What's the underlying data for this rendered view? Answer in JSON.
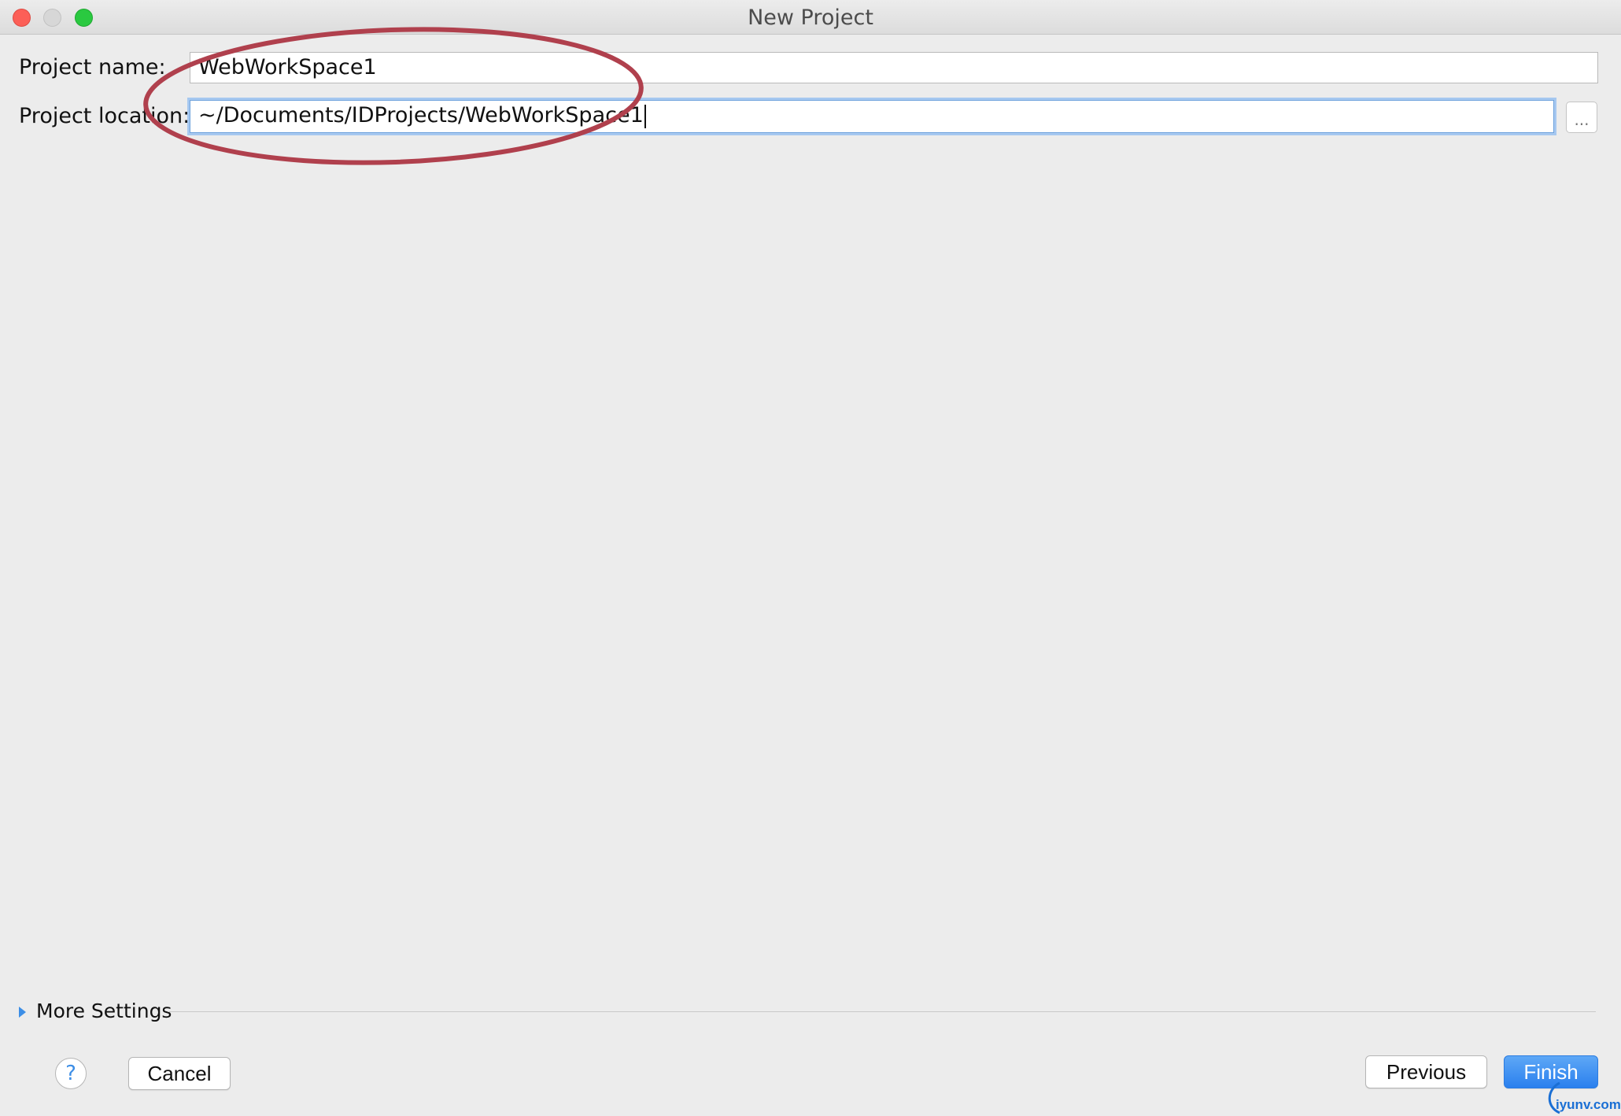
{
  "window": {
    "title": "New Project"
  },
  "form": {
    "project_name_label": "Project name:",
    "project_name_value": "WebWorkSpace1",
    "project_location_label": "Project location:",
    "project_location_value": "~/Documents/IDProjects/WebWorkSpace1",
    "browse_label": "..."
  },
  "more_settings": {
    "label": "More Settings"
  },
  "footer": {
    "help_label": "?",
    "cancel_label": "Cancel",
    "previous_label": "Previous",
    "finish_label": "Finish"
  },
  "watermark": {
    "text": "iyunv.com"
  },
  "colors": {
    "accent": "#2a80ee",
    "annotation": "#b0404d"
  }
}
